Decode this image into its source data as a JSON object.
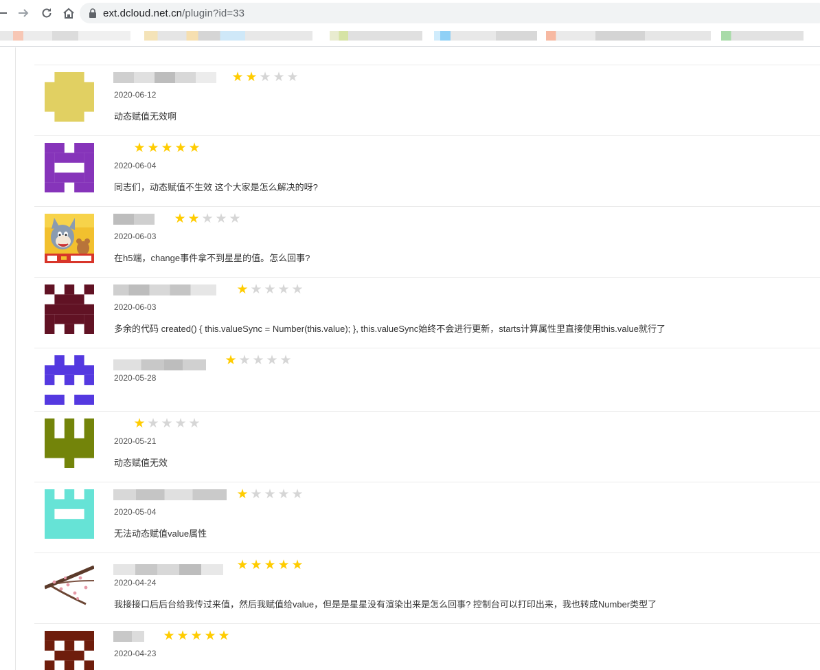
{
  "browser": {
    "url_host": "ext.dcloud.net.cn",
    "url_path": "/plugin?id=33"
  },
  "reviews": [
    {
      "date": "2020-06-12",
      "rating": 2,
      "content": "动态赋值无效啊",
      "avatar": "identicon-yellow",
      "color": "#e1d062"
    },
    {
      "date": "2020-06-04",
      "rating": 5,
      "content": "同志们，动态赋值不生效 这个大家是怎么解决的呀?",
      "avatar": "identicon-purple",
      "color": "#8634ba"
    },
    {
      "date": "2020-06-03",
      "rating": 2,
      "content": "在h5端，change事件拿不到星星的值。怎么回事?",
      "avatar": "tom-and-jerry-avatar",
      "color": "#f2c02e"
    },
    {
      "date": "2020-06-03",
      "rating": 1,
      "content": "多余的代码 created() { this.valueSync = Number(this.value); }, this.valueSync始终不会进行更新，starts计算属性里直接使用this.value就行了",
      "avatar": "identicon-maroon",
      "color": "#611224"
    },
    {
      "date": "2020-05-28",
      "rating": 1,
      "content": "",
      "avatar": "identicon-blue",
      "color": "#5439e0"
    },
    {
      "date": "2020-05-21",
      "rating": 1,
      "content": "动态赋值无效",
      "avatar": "identicon-olive",
      "color": "#73840a"
    },
    {
      "date": "2020-05-04",
      "rating": 1,
      "content": "无法动态赋值value属性",
      "avatar": "identicon-teal",
      "color": "#66e3d6"
    },
    {
      "date": "2020-04-24",
      "rating": 5,
      "content": "我接接口后后台给我传过来值，然后我赋值给value，但是是星星没有渲染出来是怎么回事? 控制台可以打印出来，我也转成Number类型了",
      "avatar": "flower-branch-avatar",
      "color": "#7a4a3a"
    },
    {
      "date": "2020-04-23",
      "rating": 5,
      "content": "",
      "avatar": "identicon-brown",
      "color": "#6e1d0c"
    }
  ],
  "star_colors": {
    "on": "#ffcc00",
    "off": "#d6d6d6"
  }
}
